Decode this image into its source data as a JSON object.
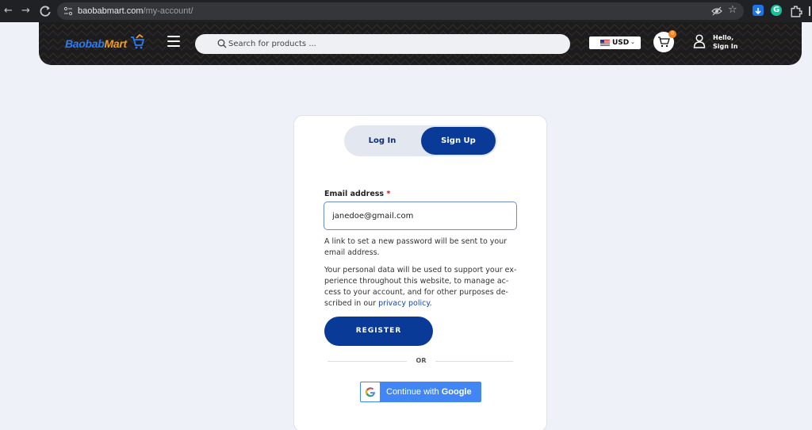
{
  "browser": {
    "url_host": "baobabmart.com",
    "url_path": "/my-account/"
  },
  "header": {
    "logo_part1": "Baobab",
    "logo_part2": "Mart",
    "search_placeholder": "Search for products ...",
    "currency": "USD",
    "cart_count": "0",
    "greeting_line1": "Hello,",
    "greeting_line2": "Sign In"
  },
  "auth": {
    "tabs": {
      "login": "Log In",
      "signup": "Sign Up",
      "active": "signup"
    },
    "email_label": "Email address",
    "required_mark": "*",
    "email_value": "janedoe@gmail.com",
    "note1": "A link to set a new password will be sent to your email address.",
    "note2_before": "Your personal data will be used to support your ex-perience throughout this website, to manage ac-cess to your account, and for other purposes de-scribed in our ",
    "privacy_link": "privacy policy",
    "note2_after": ".",
    "register_label": "REGISTER",
    "or_label": "OR",
    "google_prefix": "Continue with ",
    "google_brand": "Google"
  },
  "colors": {
    "primary": "#0a3a97",
    "accent": "#f5821f",
    "google_blue": "#4285f4",
    "page_bg": "#eef1f7"
  }
}
